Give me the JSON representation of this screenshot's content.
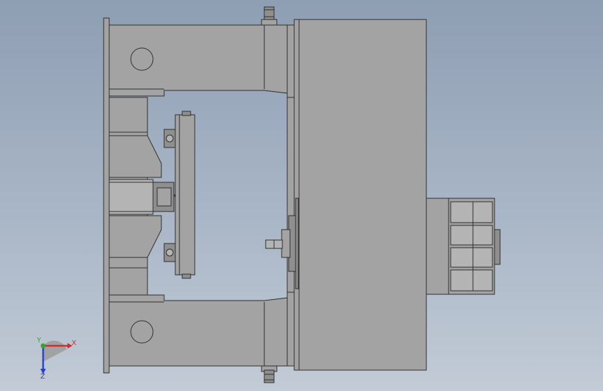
{
  "viewport": {
    "background_top": "#8e9eb3",
    "background_bottom": "#c2cbd6",
    "part_fill": "#a3a3a3",
    "part_stroke": "#2e2e2e"
  },
  "triad": {
    "x_label": "X",
    "y_label": "Y",
    "z_label": "Z",
    "x_color": "#d42a2a",
    "y_color": "#2ea82e",
    "z_color": "#2a3fd4"
  }
}
